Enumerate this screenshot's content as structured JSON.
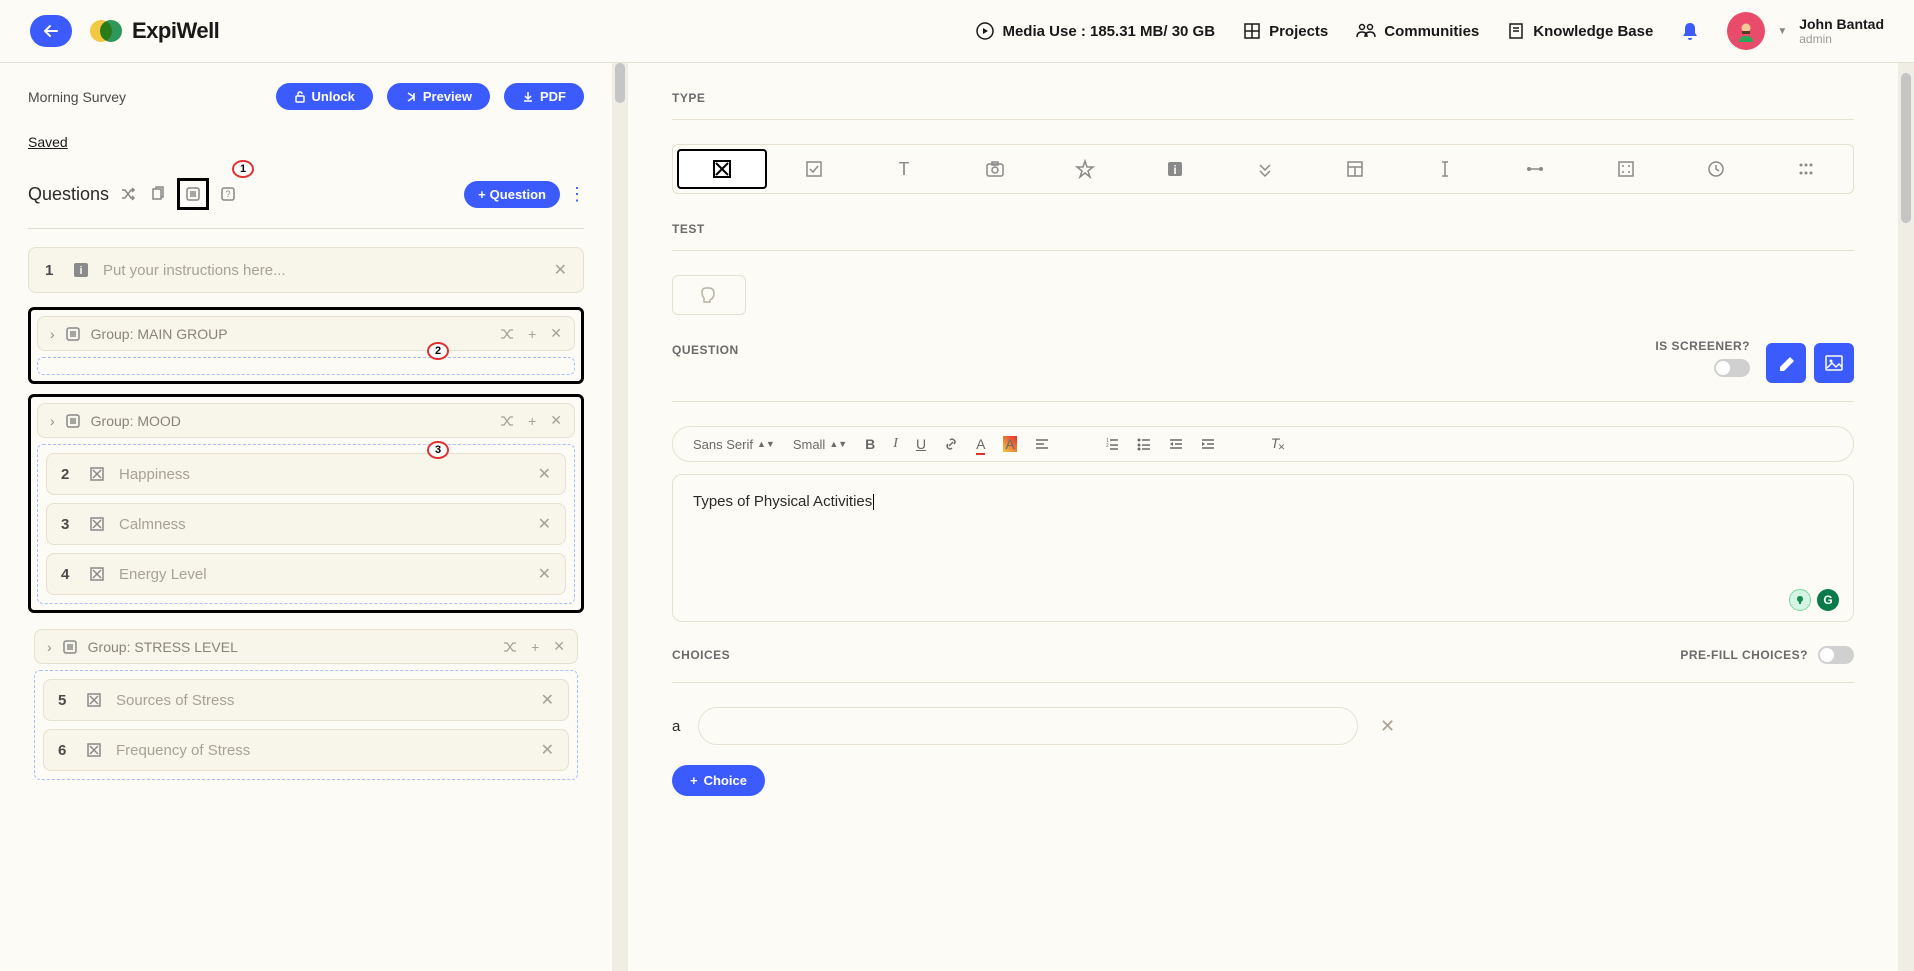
{
  "header": {
    "logo_text": "ExpiWell",
    "media_use": "Media Use : 185.31 MB/ 30 GB",
    "nav": {
      "projects": "Projects",
      "communities": "Communities",
      "knowledge_base": "Knowledge Base"
    },
    "user": {
      "name": "John Bantad",
      "role": "admin"
    }
  },
  "left": {
    "survey_title": "Morning Survey",
    "buttons": {
      "unlock": "Unlock",
      "preview": "Preview",
      "pdf": "PDF"
    },
    "saved": "Saved",
    "questions_label": "Questions",
    "add_question": "Question",
    "annotations": {
      "a1": "1",
      "a2": "2",
      "a3": "3"
    },
    "q1": {
      "num": "1",
      "text": "Put your instructions here..."
    },
    "g1": {
      "label": "Group: MAIN GROUP"
    },
    "g2": {
      "label": "Group: MOOD",
      "items": [
        {
          "num": "2",
          "text": "Happiness"
        },
        {
          "num": "3",
          "text": "Calmness"
        },
        {
          "num": "4",
          "text": "Energy Level"
        }
      ]
    },
    "g3": {
      "label": "Group: STRESS LEVEL",
      "items": [
        {
          "num": "5",
          "text": "Sources of Stress"
        },
        {
          "num": "6",
          "text": "Frequency of Stress"
        }
      ]
    }
  },
  "right": {
    "type_label": "TYPE",
    "test_label": "TEST",
    "question_label": "QUESTION",
    "screener_label": "IS SCREENER?",
    "rte": {
      "font": "Sans Serif",
      "size": "Small",
      "text": "Types of Physical Activities"
    },
    "choices_label": "CHOICES",
    "prefill_label": "PRE-FILL CHOICES?",
    "choice_a_letter": "a",
    "add_choice": "Choice"
  }
}
